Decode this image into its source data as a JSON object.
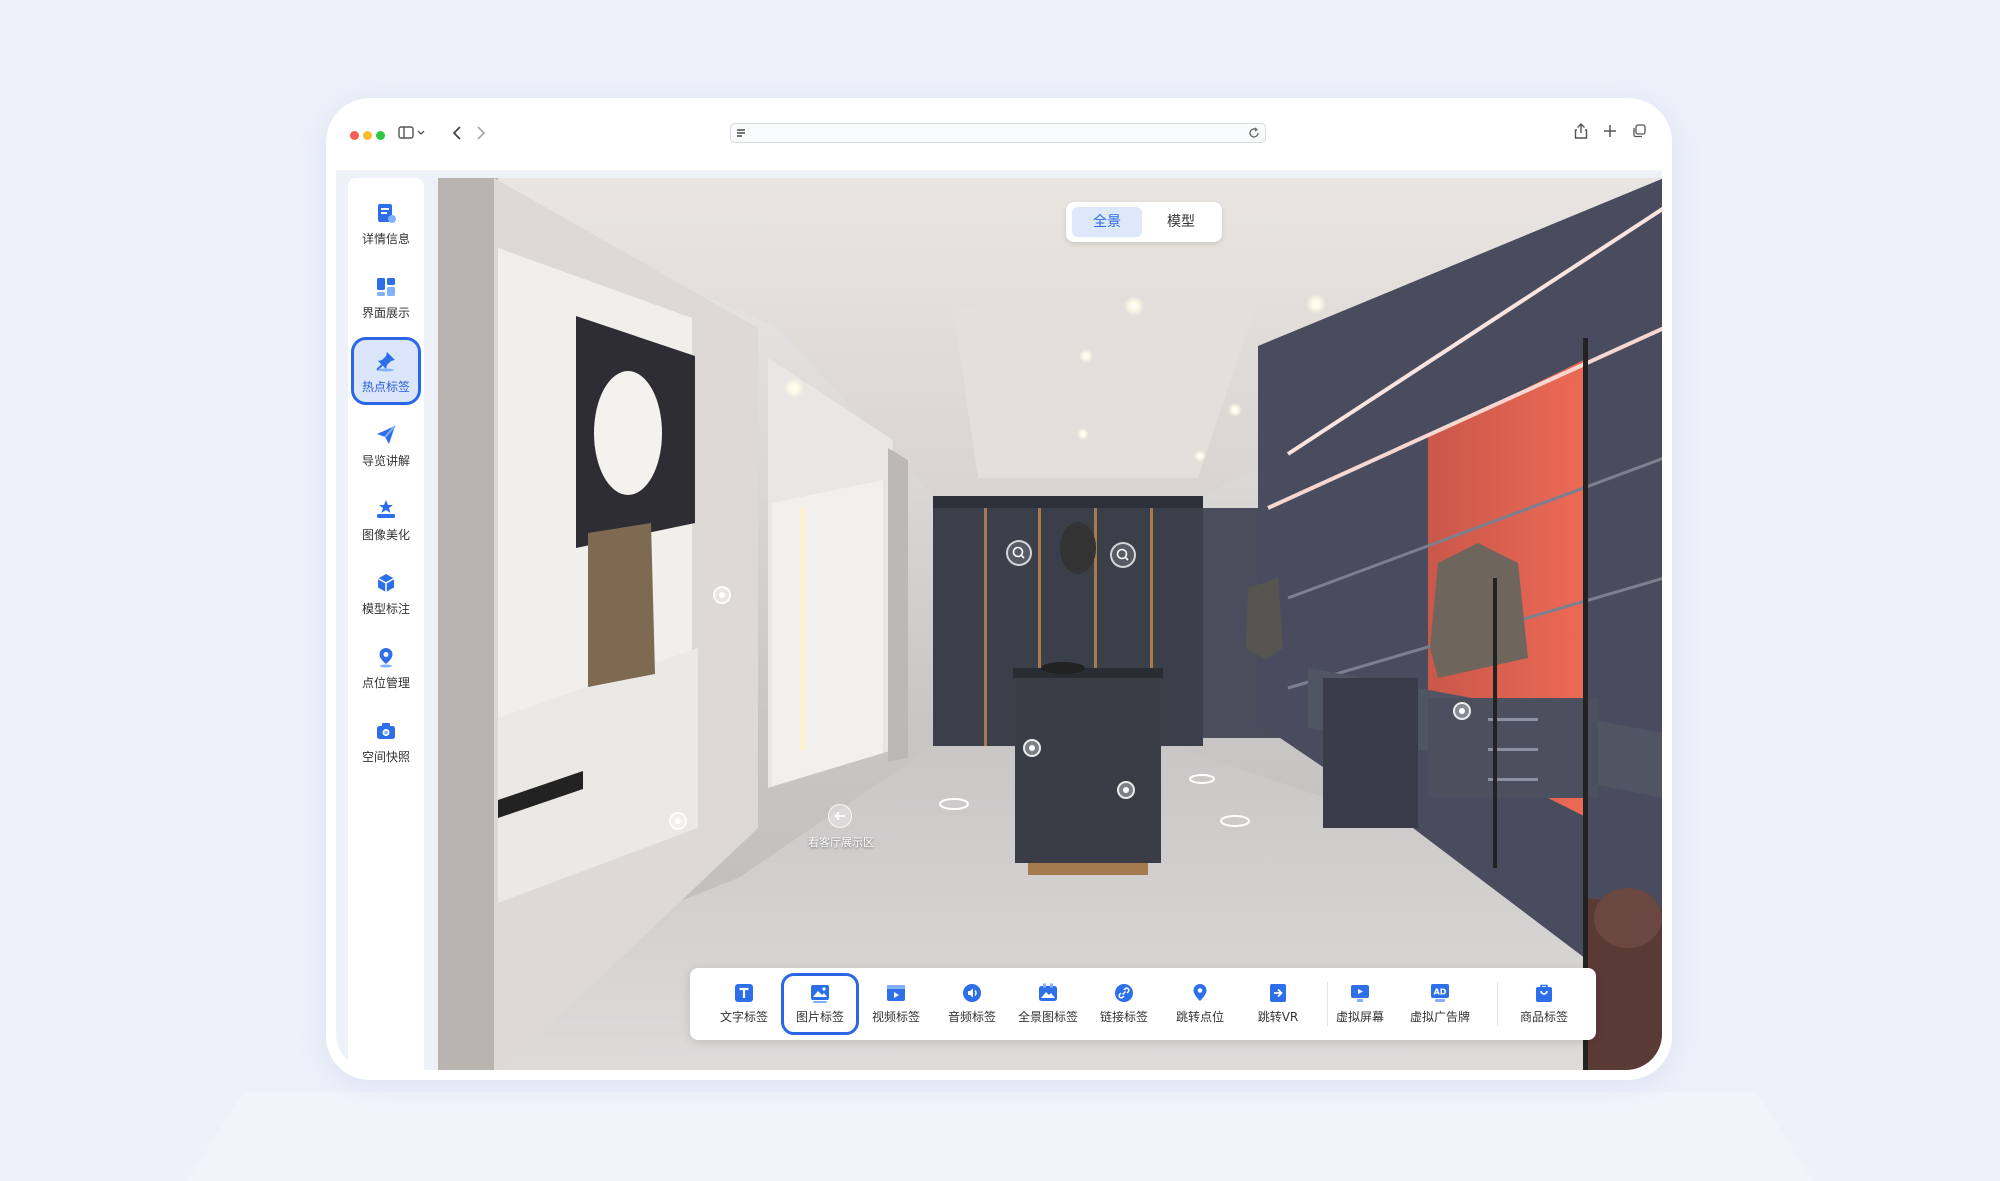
{
  "sidebar": {
    "items": [
      {
        "label": "详情信息"
      },
      {
        "label": "界面展示"
      },
      {
        "label": "热点标签",
        "active": true
      },
      {
        "label": "导览讲解"
      },
      {
        "label": "图像美化"
      },
      {
        "label": "模型标注"
      },
      {
        "label": "点位管理"
      },
      {
        "label": "空间快照"
      }
    ]
  },
  "view_toggle": {
    "panorama": "全景",
    "model": "模型",
    "selected": "全景"
  },
  "scene": {
    "area_label": "看客厅展示区"
  },
  "tag_toolbar": {
    "items": [
      {
        "label": "文字标签",
        "icon": "text-icon"
      },
      {
        "label": "图片标签",
        "icon": "image-icon",
        "active": true
      },
      {
        "label": "视频标签",
        "icon": "video-icon"
      },
      {
        "label": "音频标签",
        "icon": "audio-icon"
      },
      {
        "label": "全景图标签",
        "icon": "panorama-icon"
      },
      {
        "label": "链接标签",
        "icon": "link-icon"
      },
      {
        "label": "跳转点位",
        "icon": "location-icon"
      },
      {
        "label": "跳转VR",
        "icon": "jump-vr-icon"
      },
      {
        "label": "虚拟屏幕",
        "icon": "screen-icon"
      },
      {
        "label": "虚拟广告牌",
        "icon": "ad-icon"
      },
      {
        "label": "商品标签",
        "icon": "shopping-icon"
      }
    ]
  },
  "colors": {
    "accent": "#2b66e6",
    "icon_blue": "#2d6fe8",
    "accent_light": "#dbe6fb",
    "shelf_red": "#e8644e",
    "cabinet_dark": "#3c414c"
  }
}
